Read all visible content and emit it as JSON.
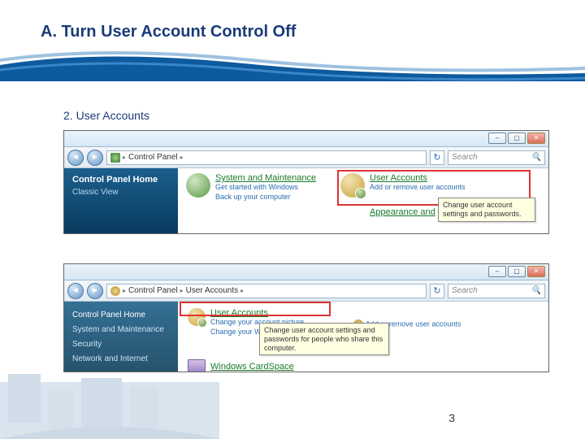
{
  "slide": {
    "title": "A. Turn User Account Control Off",
    "step": "2. User Accounts",
    "page_number": "3"
  },
  "shot1": {
    "breadcrumb": {
      "root_icon": "control-panel-icon",
      "item1": "Control Panel"
    },
    "search_placeholder": "Search",
    "sidebar": {
      "home": "Control Panel Home",
      "classic": "Classic View"
    },
    "sys": {
      "title": "System and Maintenance",
      "l1": "Get started with Windows",
      "l2": "Back up your computer"
    },
    "usr": {
      "title": "User Accounts",
      "l1": "Add or remove user accounts"
    },
    "next_cat": "Appearance and",
    "tooltip": "Change user account settings and passwords."
  },
  "shot2": {
    "breadcrumb": {
      "item1": "Control Panel",
      "item2": "User Accounts"
    },
    "search_placeholder": "Search",
    "sidebar": {
      "i0": "Control Panel Home",
      "i1": "System and Maintenance",
      "i2": "Security",
      "i3": "Network and Internet"
    },
    "ua": {
      "title": "User Accounts",
      "l1": "Change your account picture",
      "l2": "Change your Wind",
      "r1": "Add or remove user accounts"
    },
    "tooltip": "Change user account settings and passwords for people who share this computer.",
    "cardspace": "Windows CardSpace"
  }
}
